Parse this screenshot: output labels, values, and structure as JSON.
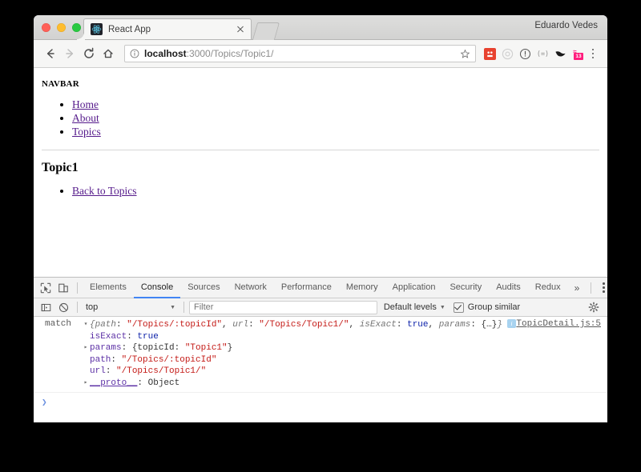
{
  "browser": {
    "profile_name": "Eduardo Vedes",
    "tab": {
      "title": "React App",
      "favicon": "react-logo-icon",
      "close": "×"
    },
    "new_tab_label": "+",
    "nav": {
      "back": "back-arrow-icon",
      "forward": "forward-arrow-icon",
      "reload": "reload-icon",
      "home": "home-icon"
    },
    "omnibox": {
      "url_host": "localhost",
      "url_path": ":3000/Topics/Topic1/",
      "full_url": "localhost:3000/Topics/Topic1/",
      "info_icon": "info-circle-icon",
      "star_icon": "bookmark-star-icon"
    },
    "extensions": [
      {
        "name": "extension-red-icon",
        "label": ""
      },
      {
        "name": "extension-gray-circle-icon",
        "label": ""
      },
      {
        "name": "extension-info-icon",
        "label": ""
      },
      {
        "name": "extension-dotted-icon",
        "label": ""
      },
      {
        "name": "extension-bird-icon",
        "label": ""
      },
      {
        "name": "extension-calendar-icon",
        "label": "13"
      }
    ],
    "menu_icon": "chrome-menu-dots-icon"
  },
  "page": {
    "navbar_heading": "NAVBAR",
    "nav_links": [
      "Home",
      "About",
      "Topics"
    ],
    "topic_title": "Topic1",
    "topic_links": [
      "Back to Topics"
    ]
  },
  "devtools": {
    "left_icons": [
      {
        "name": "inspect-element-icon"
      },
      {
        "name": "device-toolbar-icon"
      }
    ],
    "tabs": [
      {
        "label": "Elements",
        "active": false
      },
      {
        "label": "Console",
        "active": true
      },
      {
        "label": "Sources",
        "active": false
      },
      {
        "label": "Network",
        "active": false
      },
      {
        "label": "Performance",
        "active": false
      },
      {
        "label": "Memory",
        "active": false
      },
      {
        "label": "Application",
        "active": false
      },
      {
        "label": "Security",
        "active": false
      },
      {
        "label": "Audits",
        "active": false
      },
      {
        "label": "Redux",
        "active": false
      }
    ],
    "more_tabs": "»",
    "settings_dots": "⋮",
    "close": "×",
    "console_toolbar": {
      "sidebar_icon": "console-sidebar-icon",
      "clear_icon": "clear-console-icon",
      "context": "top",
      "context_caret": "▼",
      "filter_placeholder": "Filter",
      "levels_label": "Default levels",
      "levels_caret": "▼",
      "group_similar_label": "Group similar",
      "group_similar_checked": true,
      "settings_icon": "settings-gear-icon"
    },
    "console": {
      "message_label": "match",
      "source_link": "TopicDetail.js:5",
      "info_badge": "i",
      "summary": {
        "arrow": "▾",
        "open_brace": "{",
        "parts": [
          {
            "key": "path",
            "sep": ": ",
            "value": "\"/Topics/:topicId\"",
            "type": "string"
          },
          {
            "key": "url",
            "sep": ": ",
            "value": "\"/Topics/Topic1/\"",
            "type": "string"
          },
          {
            "key": "isExact",
            "sep": ": ",
            "value": "true",
            "type": "bool"
          },
          {
            "key": "params",
            "sep": ": ",
            "value": "{…}",
            "type": "obj"
          }
        ],
        "close_brace": "}"
      },
      "properties": [
        {
          "arrow": "",
          "key": "isExact",
          "sep": ": ",
          "value": "true",
          "type": "bool"
        },
        {
          "arrow": "▸",
          "key": "params",
          "sep": ": ",
          "value": "{topicId: \"Topic1\"}",
          "type": "mixed",
          "value_pre": "{topicId: ",
          "value_str": "\"Topic1\"",
          "value_post": "}"
        },
        {
          "arrow": "",
          "key": "path",
          "sep": ": ",
          "value": "\"/Topics/:topicId\"",
          "type": "string"
        },
        {
          "arrow": "",
          "key": "url",
          "sep": ": ",
          "value": "\"/Topics/Topic1/\"",
          "type": "string"
        },
        {
          "arrow": "▸",
          "key": "__proto__",
          "sep": ": ",
          "value": "Object",
          "type": "proto"
        }
      ],
      "prompt": "❯"
    }
  },
  "colors": {
    "accent_blue": "#4285f4",
    "string_red": "#c41a16",
    "bool_blue": "#0d22aa",
    "link_purple": "#551a8b",
    "react_cyan": "#61dafb"
  }
}
